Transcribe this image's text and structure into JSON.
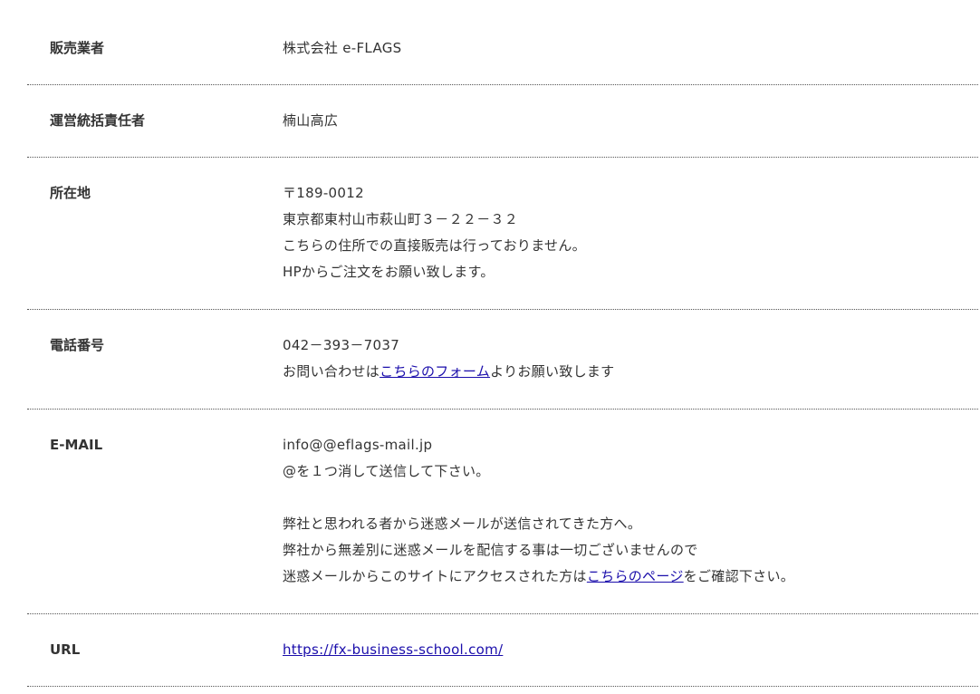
{
  "rows": [
    {
      "label": "販売業者",
      "lines": [
        "株式会社 e-FLAGS"
      ]
    },
    {
      "label": "運営統括責任者",
      "lines": [
        "楠山高広"
      ]
    },
    {
      "label": "所在地",
      "lines": [
        "〒189-0012",
        "東京都東村山市萩山町３－２２－３２",
        "こちらの住所での直接販売は行っておりません。",
        "HPからご注文をお願い致します。"
      ]
    },
    {
      "label": "電話番号",
      "line1": "042－393－7037",
      "line2_before": "お問い合わせは",
      "line2_link": "こちらのフォーム",
      "line2_after": "よりお願い致します"
    },
    {
      "label": "E-MAIL",
      "line1": "info@@eflags-mail.jp",
      "line2": "@を１つ消して送信して下さい。",
      "line3": "弊社と思われる者から迷惑メールが送信されてきた方へ。",
      "line4": "弊社から無差別に迷惑メールを配信する事は一切ございませんので",
      "line5_before": "迷惑メールからこのサイトにアクセスされた方は",
      "line5_link": "こちらのページ",
      "line5_after": "をご確認下さい。"
    },
    {
      "label": "URL",
      "link": "https://fx-business-school.com/"
    }
  ]
}
